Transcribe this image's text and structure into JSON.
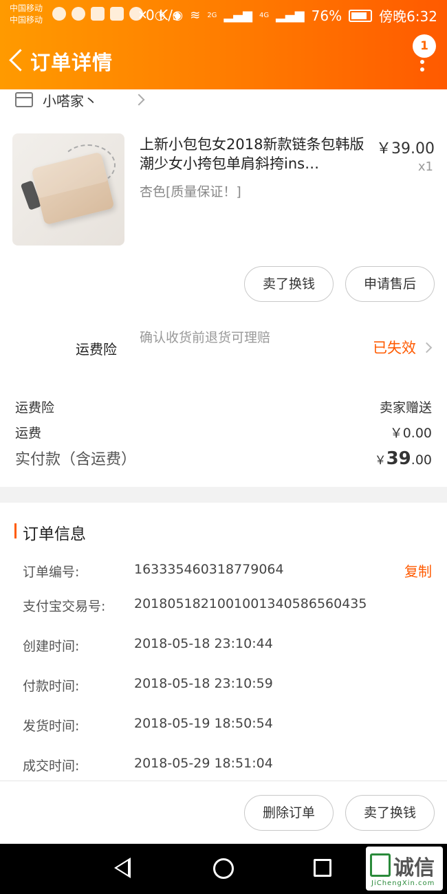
{
  "status_bar": {
    "carrier1": "中国移动",
    "carrier2": "中国移动",
    "net_speed": "0 K/s",
    "net_2g": "2G",
    "net_4g": "4G",
    "battery": "76%",
    "time": "傍晚6:32"
  },
  "header": {
    "title": "订单详情",
    "badge": "1",
    "icons": [
      "back-icon",
      "more-icon"
    ]
  },
  "shop": {
    "name": "小嗒家丶"
  },
  "product": {
    "title": "上新小包包女2018新款链条包韩版潮少女小挎包单肩斜挎ins…",
    "sku": "杏色[质量保证！]",
    "price": "￥39.00",
    "qty": "x1"
  },
  "product_actions": {
    "sell_exchange": "卖了换钱",
    "after_sale": "申请售后"
  },
  "shipping_insurance": {
    "label": "运费险",
    "desc": "确认收货前退货可理赔",
    "status": "已失效"
  },
  "fees": {
    "insurance_label": "运费险",
    "insurance_value": "卖家赠送",
    "shipping_label": "运费",
    "shipping_value": "￥0.00",
    "total_label": "实付款（含运费）",
    "total_currency": "￥",
    "total_int": "39",
    "total_dec": ".00"
  },
  "order_info": {
    "title": "订单信息",
    "copy_label": "复制",
    "rows": [
      {
        "label": "订单编号:",
        "value": "163335460318779064"
      },
      {
        "label": "支付宝交易号:",
        "value": "2018051821001001340586560435"
      },
      {
        "label": "创建时间:",
        "value": "2018-05-18 23:10:44"
      },
      {
        "label": "付款时间:",
        "value": "2018-05-18 23:10:59"
      },
      {
        "label": "发货时间:",
        "value": "2018-05-19 18:50:54"
      },
      {
        "label": "成交时间:",
        "value": "2018-05-29 18:51:04"
      }
    ]
  },
  "bottom_actions": {
    "delete": "删除订单",
    "sell_exchange": "卖了换钱"
  },
  "watermark": {
    "text": "诚信",
    "sub": "JiChengXin.com"
  },
  "colors": {
    "accent": "#ff5a00",
    "header_start": "#ff9a00",
    "header_end": "#ff5a00"
  }
}
